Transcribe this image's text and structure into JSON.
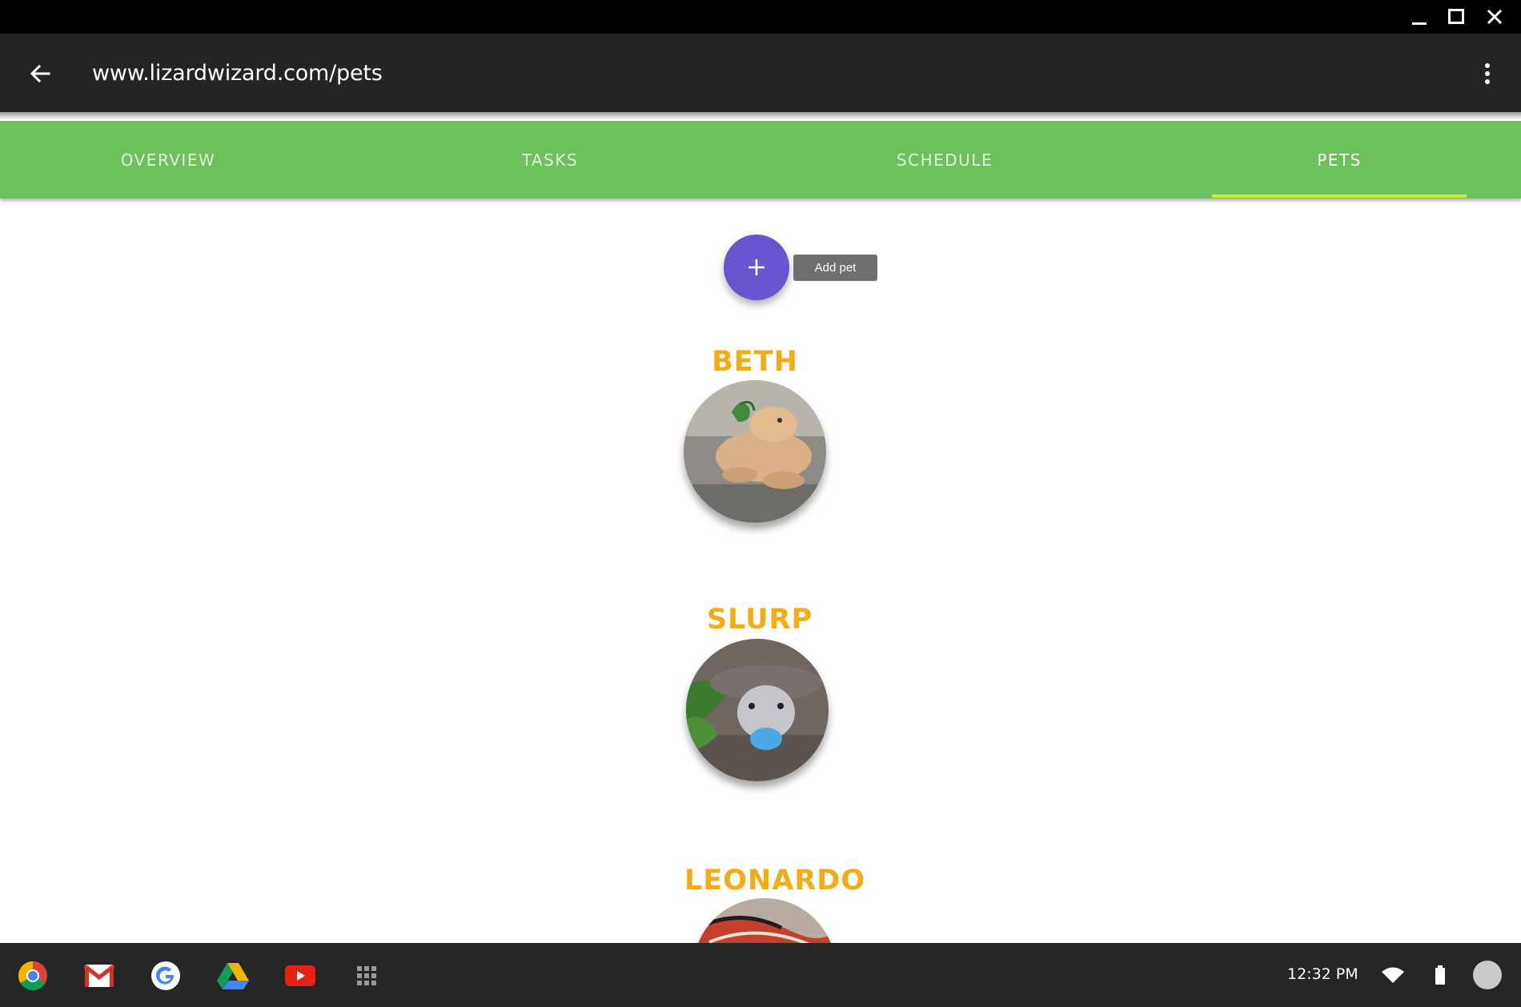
{
  "browser": {
    "url": "www.lizardwizard.com/pets"
  },
  "tabs": [
    {
      "label": "OVERVIEW",
      "active": false
    },
    {
      "label": "TASKS",
      "active": false
    },
    {
      "label": "SCHEDULE",
      "active": false
    },
    {
      "label": "PETS",
      "active": true
    }
  ],
  "add_pet": {
    "icon": "plus-icon",
    "tooltip": "Add pet"
  },
  "pets": [
    {
      "name": "BETH"
    },
    {
      "name": "SLURP"
    },
    {
      "name": "LEONARDO"
    }
  ],
  "shelf": {
    "apps": [
      "chrome-icon",
      "gmail-icon",
      "google-icon",
      "drive-icon",
      "youtube-icon",
      "launcher-icon"
    ],
    "time": "12:32 PM"
  },
  "colors": {
    "tab_bar": "#6cc15a",
    "tab_indicator": "#c6f03a",
    "fab": "#6a55d0",
    "pet_name": "#f5ac14"
  }
}
